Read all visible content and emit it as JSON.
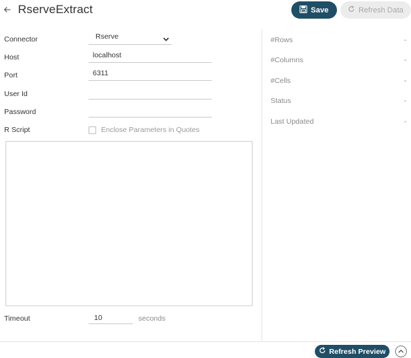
{
  "header": {
    "title": "RserveExtract",
    "back_icon": "arrow-left-icon",
    "save_label": "Save",
    "save_icon": "floppy-disk-icon",
    "refresh_data_label": "Refresh Data",
    "refresh_data_icon": "refresh-icon",
    "refresh_data_enabled": false
  },
  "form": {
    "connector": {
      "label": "Connector",
      "value": "Rserve"
    },
    "host": {
      "label": "Host",
      "value": "localhost"
    },
    "port": {
      "label": "Port",
      "value": "6311"
    },
    "user_id": {
      "label": "User Id",
      "value": ""
    },
    "password": {
      "label": "Password",
      "value": ""
    },
    "r_script": {
      "label": "R Script",
      "enclose_label": "Enclose Parameters in Quotes",
      "enclose_checked": false,
      "value": ""
    },
    "timeout": {
      "label": "Timeout",
      "value": "10",
      "unit": "seconds"
    }
  },
  "stats": [
    {
      "label": "#Rows",
      "value": "-"
    },
    {
      "label": "#Columns",
      "value": "-"
    },
    {
      "label": "#Cells",
      "value": "-"
    },
    {
      "label": "Status",
      "value": "-"
    },
    {
      "label": "Last Updated",
      "value": "-"
    }
  ],
  "footer": {
    "refresh_preview_label": "Refresh Preview",
    "refresh_preview_icon": "refresh-icon",
    "collapse_icon": "chevron-up-icon"
  },
  "colors": {
    "primary": "#1f4e66",
    "disabled_bg": "#ececec",
    "disabled_text": "#a9a9a9",
    "divider": "#e3e3e3",
    "muted_text": "#8a8a8a"
  }
}
